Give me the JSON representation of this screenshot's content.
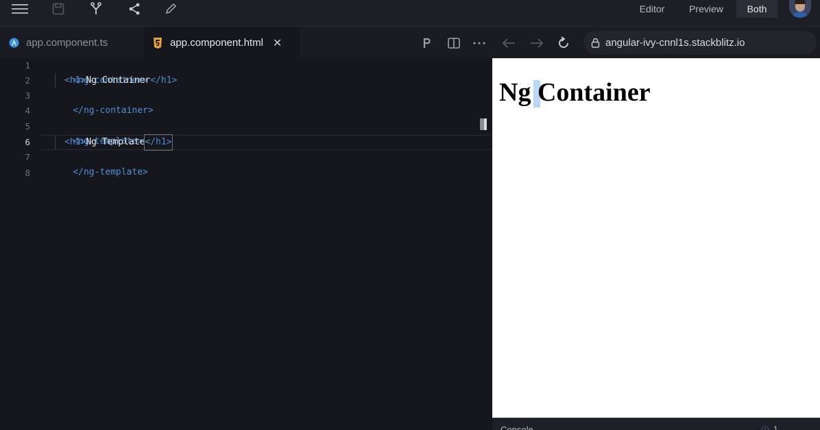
{
  "toolbar": {
    "view_editor": "Editor",
    "view_preview": "Preview",
    "view_both": "Both",
    "active_view": "Both"
  },
  "tabs": [
    {
      "label": "app.component.ts",
      "icon": "angular-ts-icon",
      "active": false
    },
    {
      "label": "app.component.html",
      "icon": "html5-icon",
      "active": true,
      "close": "✕"
    }
  ],
  "url": "angular-ivy-cnnl1s.stackblitz.io",
  "editor": {
    "current_line": 6,
    "line_numbers": [
      "1",
      "2",
      "3",
      "4",
      "5",
      "6",
      "7",
      "8"
    ],
    "lines": [
      {
        "open": "<ng-container>"
      },
      {
        "open": "<h1>",
        "text": "Ng Container",
        "close": "</h1>"
      },
      {
        "open": "</ng-container>"
      },
      {
        "open": ""
      },
      {
        "open": "<ng-template>"
      },
      {
        "open": "<h1>",
        "text": "Ng Template",
        "close": "</h1>"
      },
      {
        "open": "</ng-template>"
      },
      {
        "open": ""
      }
    ]
  },
  "preview": {
    "heading": "Ng Container"
  },
  "console": {
    "label": "Console",
    "count": "1"
  },
  "colors": {
    "background": "#16171d",
    "tag": "#4f8fd6",
    "text": "#e3e5ea",
    "selection": "#bcd7f5"
  }
}
